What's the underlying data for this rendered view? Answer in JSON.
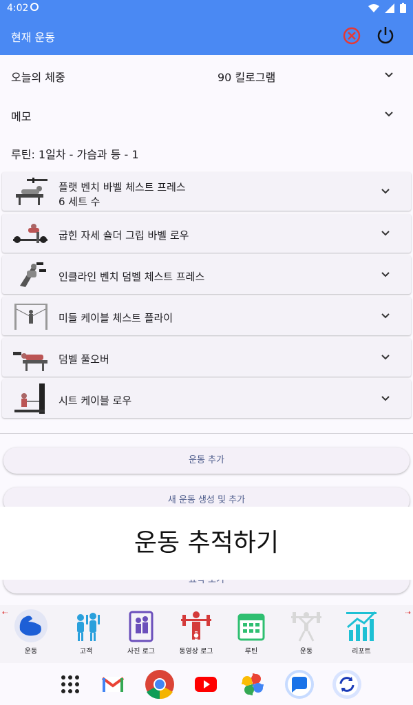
{
  "status_bar": {
    "time": "4:02"
  },
  "app_bar": {
    "title": "현재 운동"
  },
  "weight": {
    "label": "오늘의 체중",
    "value": "90 킬로그램"
  },
  "memo": {
    "label": "메모"
  },
  "routine": {
    "label": "루틴: 1일차 - 가슴과 등 - 1"
  },
  "exercises": [
    {
      "name": "플랫 벤치 바벨 체스트 프레스",
      "sets": "6 세트 수"
    },
    {
      "name": "굽힌 자세 숄더 그립 바벨 로우"
    },
    {
      "name": "인클라인 벤치 덤벨 체스트 프레스"
    },
    {
      "name": "미들 케이블 체스트 플라이"
    },
    {
      "name": "덤벨 풀오버"
    },
    {
      "name": "시트 케이블 로우"
    }
  ],
  "buttons": {
    "add_exercise": "운동 추가",
    "create_and_add": "새 운동 생성 및 추가",
    "summary": "요약 보기"
  },
  "overlay": {
    "text": "운동 추적하기"
  },
  "bottom_nav": [
    {
      "label": "운동",
      "icon": "muscle-arm-icon"
    },
    {
      "label": "고객",
      "icon": "trainer-client-icon"
    },
    {
      "label": "사진 로그",
      "icon": "mirror-photo-icon"
    },
    {
      "label": "동영상 로그",
      "icon": "weightlifter-video-icon"
    },
    {
      "label": "루틴",
      "icon": "calendar-icon"
    },
    {
      "label": "운동",
      "icon": "barbell-person-icon"
    },
    {
      "label": "리포트",
      "icon": "chart-icon"
    }
  ],
  "dock": [
    "apps-grid-icon",
    "gmail-icon",
    "chrome-icon",
    "youtube-icon",
    "photos-icon",
    "messages-icon",
    "sync-app-icon"
  ],
  "colors": {
    "app_bar": "#4a89f3",
    "accent_text": "#4e5d8c"
  }
}
